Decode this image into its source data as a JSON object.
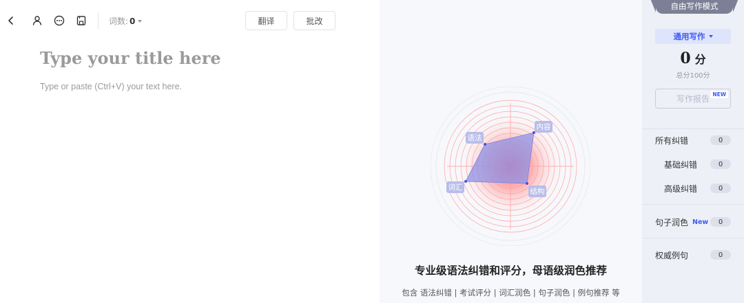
{
  "toolbar": {
    "word_count_label": "词数:",
    "word_count_value": "0",
    "translate_label": "翻译",
    "correct_label": "批改",
    "icons": [
      "back-icon",
      "user-icon",
      "more-icon",
      "save-icon"
    ]
  },
  "editor": {
    "title_placeholder": "Type your title here",
    "body_placeholder": "Type or paste (Ctrl+V) your text here."
  },
  "promo": {
    "radar_labels": {
      "content": "内容",
      "grammar": "语法",
      "vocab": "词汇",
      "structure": "结构"
    },
    "headline": "专业级语法纠错和评分，母语级润色推荐",
    "subline": "包含 语法纠错 | 考试评分 | 词汇润色 | 句子润色 | 例句推荐 等"
  },
  "panel": {
    "mode_tab": "自由写作模式",
    "mode_select": "通用写作",
    "score_value": "0",
    "score_unit": "分",
    "score_total": "总分100分",
    "report_button": "写作报告",
    "report_badge": "NEW",
    "rows": [
      {
        "label": "所有纠错",
        "count": "0"
      },
      {
        "label": "基础纠错",
        "count": "0"
      },
      {
        "label": "高级纠错",
        "count": "0"
      },
      {
        "label": "句子润色",
        "tag": "New",
        "count": "0"
      },
      {
        "label": "权威例句",
        "count": "0"
      }
    ]
  },
  "colors": {
    "accent": "#3d5af1",
    "panel_bg": "#eef0f8",
    "promo_bg": "#f7f8fb",
    "radar_fill": "#8f93e6"
  }
}
